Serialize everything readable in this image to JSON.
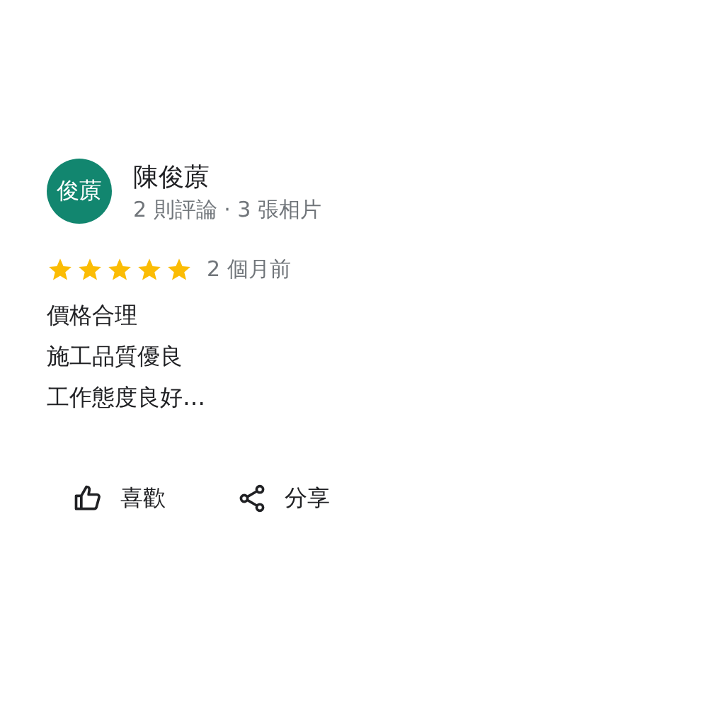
{
  "reviewer": {
    "avatar_text": "俊蒝",
    "name": "陳俊蒝",
    "meta": "2 則評論 · 3 張相片"
  },
  "review": {
    "stars": 5,
    "time": "2 個月前",
    "lines": [
      "價格合理",
      "施工品質優良",
      "工作態度良好…"
    ]
  },
  "actions": [
    {
      "kind": "like",
      "label": "喜歡"
    },
    {
      "kind": "share",
      "label": "分享"
    }
  ]
}
